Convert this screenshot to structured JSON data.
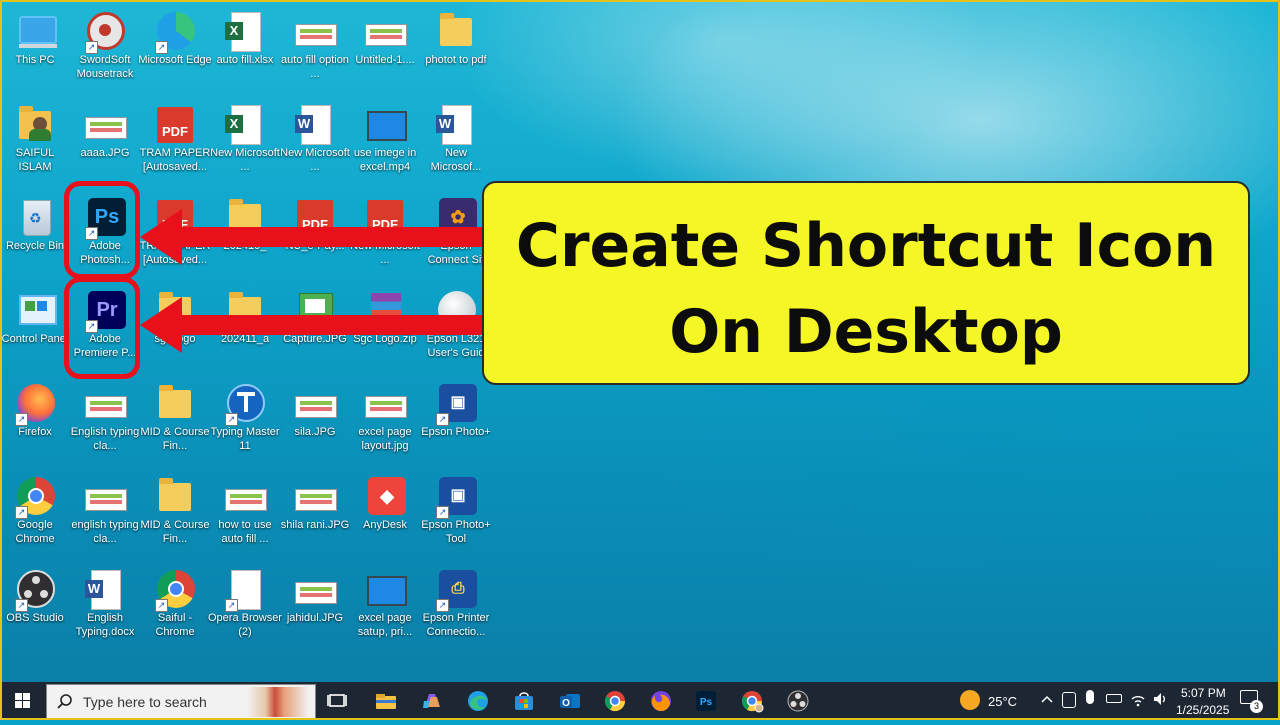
{
  "desktop": {
    "icons": [
      {
        "label": "This PC",
        "col": 0,
        "row": 0,
        "kind": "pc",
        "shortcut": false
      },
      {
        "label": "SwordSoft Mousetrack",
        "col": 1,
        "row": 0,
        "kind": "mousetrack",
        "shortcut": true
      },
      {
        "label": "Microsoft Edge",
        "col": 2,
        "row": 0,
        "kind": "edge",
        "shortcut": true
      },
      {
        "label": "auto fill.xlsx",
        "col": 3,
        "row": 0,
        "kind": "excel",
        "shortcut": false
      },
      {
        "label": "auto fill option ...",
        "col": 4,
        "row": 0,
        "kind": "image",
        "shortcut": false
      },
      {
        "label": "Untitled-1....",
        "col": 5,
        "row": 0,
        "kind": "image",
        "shortcut": false
      },
      {
        "label": "photot to pdf",
        "col": 6,
        "row": 0,
        "kind": "folder",
        "shortcut": false
      },
      {
        "label": "SAIFUL ISLAM",
        "col": 0,
        "row": 1,
        "kind": "user-folder",
        "shortcut": false
      },
      {
        "label": "aaaa.JPG",
        "col": 1,
        "row": 1,
        "kind": "image",
        "shortcut": false
      },
      {
        "label": "TRAM PAPER [Autosaved...",
        "col": 2,
        "row": 1,
        "kind": "pdf",
        "shortcut": false
      },
      {
        "label": "New Microsoft ...",
        "col": 3,
        "row": 1,
        "kind": "excel",
        "shortcut": false
      },
      {
        "label": "New Microsoft ...",
        "col": 4,
        "row": 1,
        "kind": "word",
        "shortcut": false
      },
      {
        "label": "use imege in excel.mp4",
        "col": 5,
        "row": 1,
        "kind": "video",
        "shortcut": false
      },
      {
        "label": "New Microsof...",
        "col": 6,
        "row": 1,
        "kind": "word",
        "shortcut": false
      },
      {
        "label": "Recycle Bin",
        "col": 0,
        "row": 2,
        "kind": "recycle",
        "shortcut": false
      },
      {
        "label": "Adobe Photosh...",
        "col": 1,
        "row": 2,
        "kind": "photoshop",
        "shortcut": true
      },
      {
        "label": "TRAM PAPER [Autosaved...",
        "col": 2,
        "row": 2,
        "kind": "pdf",
        "shortcut": false
      },
      {
        "label": "202410_",
        "col": 3,
        "row": 2,
        "kind": "folder",
        "shortcut": false
      },
      {
        "label": "NU_e-Pay...",
        "col": 4,
        "row": 2,
        "kind": "pdf",
        "shortcut": false
      },
      {
        "label": "New Microsoft ...",
        "col": 5,
        "row": 2,
        "kind": "pdf",
        "shortcut": false
      },
      {
        "label": "Epson Connect Sit",
        "col": 6,
        "row": 2,
        "kind": "epson-connect",
        "shortcut": true
      },
      {
        "label": "Control Panel",
        "col": 0,
        "row": 3,
        "kind": "control",
        "shortcut": false
      },
      {
        "label": "Adobe Premiere P...",
        "col": 1,
        "row": 3,
        "kind": "premiere",
        "shortcut": true
      },
      {
        "label": "sgc logo",
        "col": 2,
        "row": 3,
        "kind": "folder",
        "shortcut": false
      },
      {
        "label": "202411_a",
        "col": 3,
        "row": 3,
        "kind": "folder",
        "shortcut": false
      },
      {
        "label": "Capture.JPG",
        "col": 4,
        "row": 3,
        "kind": "capture",
        "shortcut": false
      },
      {
        "label": "Sgc Logo.zip",
        "col": 5,
        "row": 3,
        "kind": "zip",
        "shortcut": false
      },
      {
        "label": "Epson L321 User's Guid",
        "col": 6,
        "row": 3,
        "kind": "guide",
        "shortcut": true
      },
      {
        "label": "Firefox",
        "col": 0,
        "row": 4,
        "kind": "firefox",
        "shortcut": true
      },
      {
        "label": "English typing cla...",
        "col": 1,
        "row": 4,
        "kind": "image",
        "shortcut": false
      },
      {
        "label": "MID & Course Fin...",
        "col": 2,
        "row": 4,
        "kind": "folder",
        "shortcut": false
      },
      {
        "label": "Typing Master 11",
        "col": 3,
        "row": 4,
        "kind": "typing",
        "shortcut": true
      },
      {
        "label": "sila.JPG",
        "col": 4,
        "row": 4,
        "kind": "image",
        "shortcut": false
      },
      {
        "label": "excel page layout.jpg",
        "col": 5,
        "row": 4,
        "kind": "image",
        "shortcut": false
      },
      {
        "label": "Epson Photo+",
        "col": 6,
        "row": 4,
        "kind": "epson-photo",
        "shortcut": true
      },
      {
        "label": "Google Chrome",
        "col": 0,
        "row": 5,
        "kind": "chrome",
        "shortcut": true
      },
      {
        "label": "english typing cla...",
        "col": 1,
        "row": 5,
        "kind": "image",
        "shortcut": false
      },
      {
        "label": "MID & Course Fin...",
        "col": 2,
        "row": 5,
        "kind": "folder",
        "shortcut": false
      },
      {
        "label": "how to use auto fill ...",
        "col": 3,
        "row": 5,
        "kind": "image",
        "shortcut": false
      },
      {
        "label": "shila rani.JPG",
        "col": 4,
        "row": 5,
        "kind": "image",
        "shortcut": false
      },
      {
        "label": "AnyDesk",
        "col": 5,
        "row": 5,
        "kind": "anydesk",
        "shortcut": false
      },
      {
        "label": "Epson Photo+ Tool",
        "col": 6,
        "row": 5,
        "kind": "epson-photo",
        "shortcut": true
      },
      {
        "label": "OBS Studio",
        "col": 0,
        "row": 6,
        "kind": "obs",
        "shortcut": true
      },
      {
        "label": "English Typing.docx",
        "col": 1,
        "row": 6,
        "kind": "word",
        "shortcut": false
      },
      {
        "label": "Saiful - Chrome",
        "col": 2,
        "row": 6,
        "kind": "chrome",
        "shortcut": true
      },
      {
        "label": "Opera Browser (2)",
        "col": 3,
        "row": 6,
        "kind": "blank",
        "shortcut": true
      },
      {
        "label": "jahidul.JPG",
        "col": 4,
        "row": 6,
        "kind": "image",
        "shortcut": false
      },
      {
        "label": "excel page satup, pri...",
        "col": 5,
        "row": 6,
        "kind": "video",
        "shortcut": false
      },
      {
        "label": "Epson Printer Connectio...",
        "col": 6,
        "row": 6,
        "kind": "epson-printer",
        "shortcut": true
      }
    ]
  },
  "callout": {
    "line1": "Create Shortcut Icon",
    "line2": "On Desktop"
  },
  "taskbar": {
    "search_placeholder": "Type here to search",
    "weather_temp": "25°C",
    "time": "5:07 PM",
    "date": "1/25/2025",
    "notification_count": "3",
    "pinned": [
      "task-view",
      "file-explorer",
      "copilot",
      "edge",
      "store",
      "outlook",
      "chrome",
      "firefox",
      "photoshop",
      "chrome-profile",
      "obs"
    ]
  },
  "colors": {
    "callout_bg": "#f4f625",
    "arrow_red": "#e8101a",
    "taskbar_bg": "#1d2733"
  }
}
